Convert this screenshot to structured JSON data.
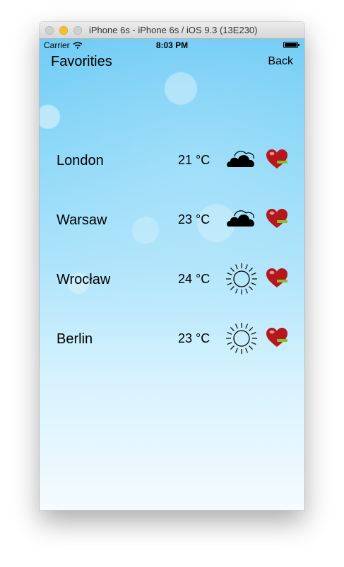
{
  "window": {
    "title": "iPhone 6s - iPhone 6s / iOS 9.3 (13E230)"
  },
  "status_bar": {
    "carrier": "Carrier",
    "time": "8:03 PM"
  },
  "nav": {
    "title": "Favorities",
    "back_label": "Back"
  },
  "favorites": [
    {
      "city": "London",
      "temperature": "21 °C",
      "weather_icon": "cloud-icon",
      "action_icon": "heart-remove-icon"
    },
    {
      "city": "Warsaw",
      "temperature": "23 °C",
      "weather_icon": "cloud-icon",
      "action_icon": "heart-remove-icon"
    },
    {
      "city": "Wrocław",
      "temperature": "24 °C",
      "weather_icon": "sun-icon",
      "action_icon": "heart-remove-icon"
    },
    {
      "city": "Berlin",
      "temperature": "23 °C",
      "weather_icon": "sun-icon",
      "action_icon": "heart-remove-icon"
    }
  ],
  "colors": {
    "sky_top": "#72ccf5",
    "sky_bottom": "#f5fbff",
    "heart": "#b5171c",
    "minus_badge": "#8bbd2a"
  }
}
